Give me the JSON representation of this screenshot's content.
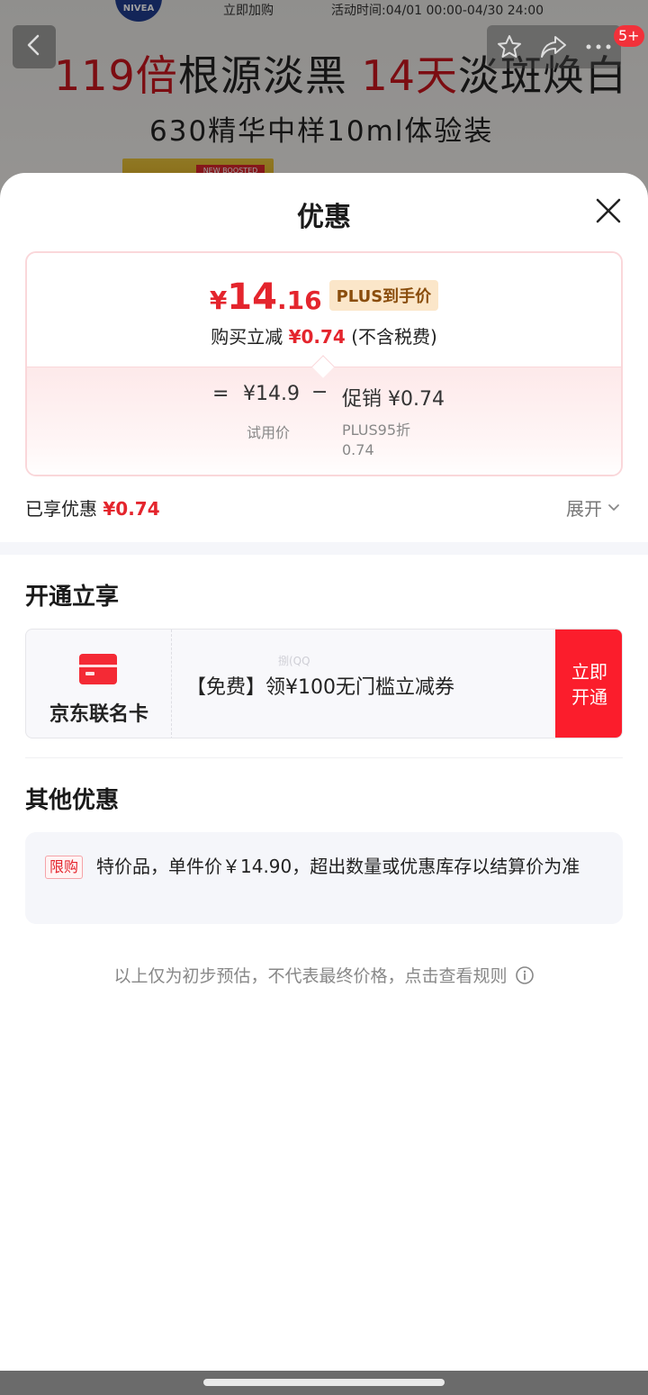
{
  "background": {
    "brand_logo": "NIVEA",
    "buy_now": "立即加购",
    "activity_time": "活动时间:04/01 00:00-04/30 24:00",
    "headline_red_1": "119倍",
    "headline_black_1": "根源淡黑 ",
    "headline_red_2": "14天",
    "headline_black_2": "淡斑焕白",
    "subline": "630精华中样10ml体验装",
    "product_tag": "NEW BOOSTED",
    "cart_badge": "5+",
    "icons": [
      "back-arrow-icon",
      "star-icon",
      "share-icon",
      "more-icon"
    ]
  },
  "sheet": {
    "title": "优惠",
    "price_card": {
      "currency": "¥",
      "price_int": "14",
      "price_dec": ".16",
      "plus_tag": "PLUS到手价",
      "reduce_label": "购买立减",
      "reduce_amount": "¥0.74",
      "tax_note": "(不含税费)",
      "eq": "=",
      "base_price": "¥14.9",
      "base_label": "试用价",
      "minus": "−",
      "promo": "促销 ¥0.74",
      "promo_label": "PLUS95折 0.74"
    },
    "enjoyed_label": "已享优惠",
    "enjoyed_amount": "¥0.74",
    "expand": "展开",
    "open_section": {
      "title": "开通立享",
      "card_name": "京东联名卡",
      "offer_text": "【免费】领¥100无门槛立减券",
      "watermark": "捌(QQ",
      "button": "立即开通"
    },
    "other_section": {
      "title": "其他优惠",
      "tag": "限购",
      "text": "特价品，单件价￥14.90，超出数量或优惠库存以结算价为准"
    },
    "disclaimer": "以上仅为初步预估，不代表最终价格，点击查看规则"
  },
  "colors": {
    "accent_red": "#e4252d",
    "button_red": "#fb1d2c",
    "plus_tag_bg": "#fbe6c9",
    "plus_tag_text": "#8a4d0c"
  }
}
